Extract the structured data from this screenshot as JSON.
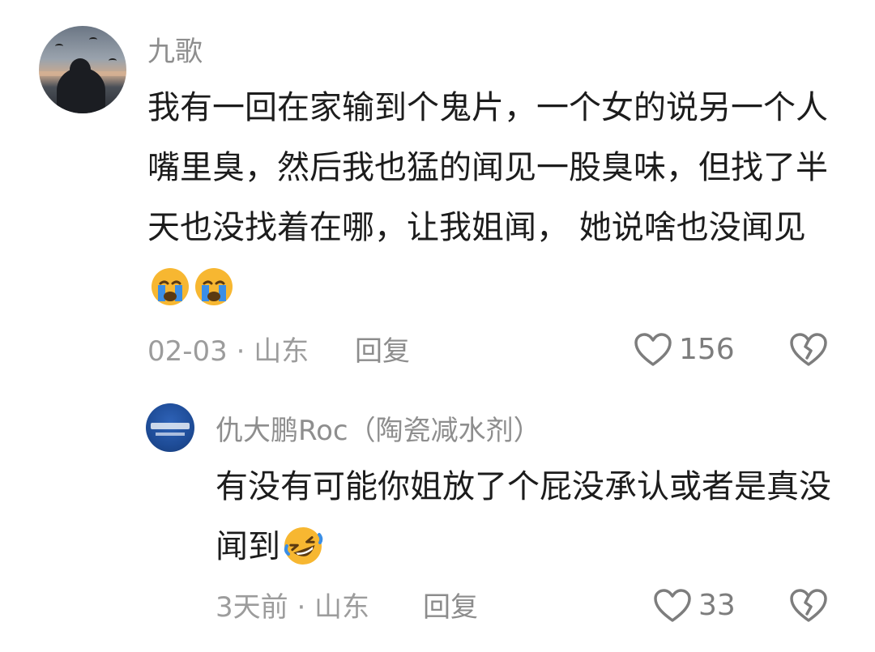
{
  "comment": {
    "username": "九歌",
    "text": "我有一回在家输到个鬼片，一个女的说另一个人嘴里臭，然后我也猛的闻见一股臭味，但找了半天也没找着在哪，让我姐闻， 她说啥也没闻见",
    "emojis": [
      "crying-face",
      "crying-face"
    ],
    "meta": "02-03 · 山东",
    "reply_label": "回复",
    "likes": "156"
  },
  "reply": {
    "username": "仇大鹏Roc（陶瓷减水剂）",
    "text": "有没有可能你姐放了个屁没承认或者是真没闻到",
    "emojis": [
      "rolling-laughing-face"
    ],
    "meta": "3天前 · 山东",
    "reply_label": "回复",
    "likes": "33"
  },
  "colors": {
    "text": "#1c1c1c",
    "muted": "#8e8e8e",
    "emoji_yellow": "#f7b731",
    "tear_blue": "#3a8ee6"
  }
}
